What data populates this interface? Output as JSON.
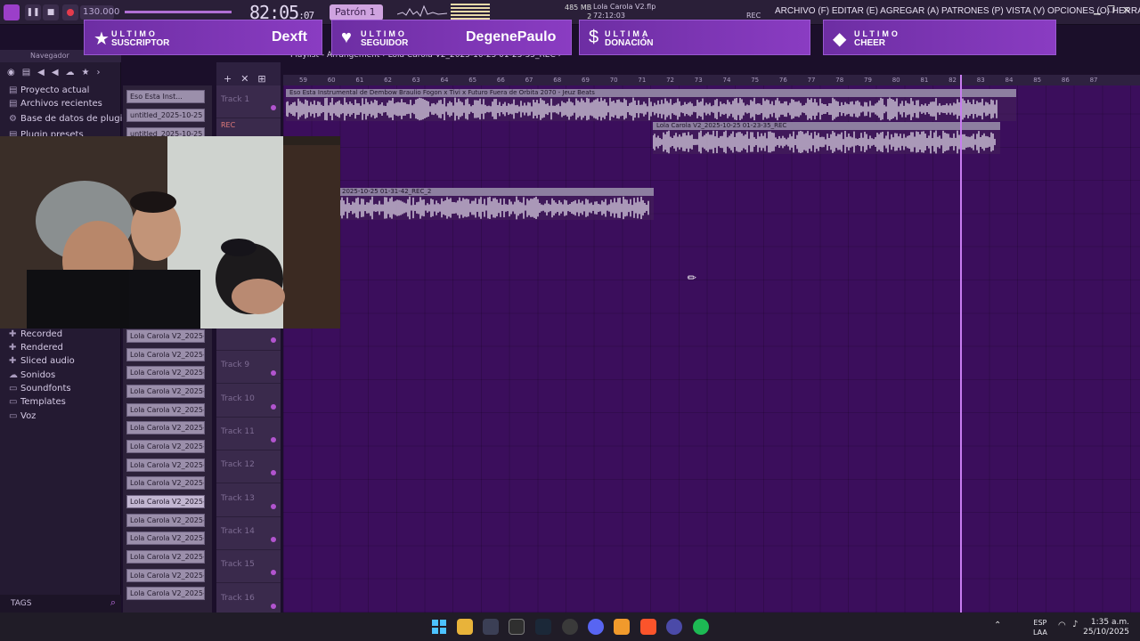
{
  "toolbar": {
    "tempo": "130.000",
    "time_main": "82:05",
    "time_sub": ":07",
    "pattern": "Patrón 1",
    "song_file": "Lola Carola V2.flp",
    "song_time": "72:12:03",
    "memory": "485 MB",
    "cpu": "2",
    "rec_label": "REC",
    "menu": "ARCHIVO (F)  EDITAR (E)  AGREGAR (A)  PATRONES (P)  VISTA (V)  OPCIONES (O)  HERRAMIENTAS (T)  AYUDA"
  },
  "banners": [
    {
      "kind": "ULTIMO",
      "type": "SUSCRIPTOR",
      "user": "Dexft"
    },
    {
      "kind": "ULTIMO",
      "type": "SEGUIDOR",
      "user": "DegenePaulo"
    },
    {
      "kind": "ULTIMA",
      "type": "DONACIÓN",
      "user": ""
    },
    {
      "kind": "ULTIMO",
      "type": "CHEER",
      "user": ""
    }
  ],
  "browser": {
    "title": "Navegador",
    "items": [
      "Proyecto actual",
      "Archivos recientes",
      "Base de datos de plugins",
      "Plugin presets"
    ],
    "folders": [
      "Recorded",
      "Rendered",
      "Sliced audio",
      "Sonidos",
      "Soundfonts",
      "Templates",
      "Voz"
    ],
    "tags": "TAGS"
  },
  "picker": {
    "top_clips": [
      "Eso Esta  Inst...",
      "untitled_2025-10-25 01-...",
      "untitled_2025-10-25 01-..."
    ],
    "clips": [
      "Lola Carola V2_2025-10-...",
      "Lola Carola V2_2025-10-...",
      "Lola Carola V2_2025-10-...",
      "Lola Carola V2_2025-10-...",
      "Lola Carola V2_2025-10-...",
      "Lola Carola V2_2025-10-...",
      "Lola Carola V2_2025-10-...",
      "Lola Carola V2_2025-10-...",
      "Lola Carola V2_2025-10-...",
      "Lola Carola V2_2025-10-...",
      "Lola Carola V2_2025-10-...",
      "Lola Carola V2_2025-10-...",
      "Lola Carola V2_2025-10-...",
      "Lola Carola V2_2025-10-...",
      "Lola Carola V2_2025-10-..."
    ]
  },
  "playlist": {
    "title": "Playlist - Arrangement › Lola Carola V2_2025-10-25 01-23-35_REC ›",
    "tracks": [
      "Track 1",
      "",
      "",
      "",
      "",
      "",
      "",
      "",
      "Track 9",
      "Track 10",
      "Track 11",
      "Track 12",
      "Track 13",
      "Track 14",
      "Track 15",
      "Track 16"
    ],
    "rec_label": "REC",
    "ruler": [
      "59",
      "60",
      "61",
      "62",
      "63",
      "64",
      "65",
      "66",
      "67",
      "68",
      "69",
      "70",
      "71",
      "72",
      "73",
      "74",
      "75",
      "76",
      "77",
      "78",
      "79",
      "80",
      "81",
      "82",
      "83",
      "84",
      "85",
      "86",
      "87"
    ],
    "clip1": "Eso Esta  Instrumental de Dembow  Braulio Fogon x Tivi x Futuro Fuera de Orbita 2070 - Jeuz Beats",
    "clip2": "Lola Carola V2_2025-10-25 01-23-35_REC",
    "clip3": "2025-10-25 01-31-42_REC_2"
  },
  "taskbar": {
    "lang1": "ESP",
    "lang2": "LAA",
    "time": "1:35 a.m.",
    "date": "25/10/2025"
  }
}
